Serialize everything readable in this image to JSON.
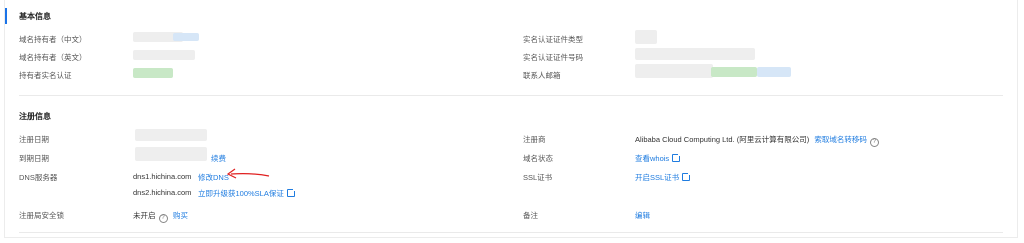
{
  "basic": {
    "title": "基本信息",
    "owner_cn_label": "域名持有者（中文）",
    "owner_en_label": "域名持有者（英文）",
    "realname_label": "持有者实名认证",
    "id_type_label": "实名认证证件类型",
    "id_number_label": "实名认证证件号码",
    "email_label": "联系人邮箱"
  },
  "registration": {
    "title": "注册信息",
    "reg_date_label": "注册日期",
    "expire_label": "到期日期",
    "renew_link": "续费",
    "dns_label": "DNS服务器",
    "dns1": "dns1.hichina.com",
    "modify_dns_link": "修改DNS",
    "dns2": "dns2.hichina.com",
    "upgrade_sla_link": "立即升级获100%SLA保证",
    "security_lock_label": "注册局安全锁",
    "security_lock_value": "未开启",
    "buy_link": "购买",
    "registrar_label": "注册商",
    "registrar_value": "Alibaba Cloud Computing Ltd. (阿里云计算有限公司)",
    "transfer_code_link": "索取域名转移码",
    "status_label": "域名状态",
    "whois_link": "查看whois",
    "ssl_label": "SSL证书",
    "ssl_link": "开启SSL证书",
    "remark_label": "备注",
    "edit_link": "编辑"
  },
  "colors": {
    "accent": "#1a73e8",
    "link": "#1f7ce0",
    "arrow": "#e02020"
  }
}
